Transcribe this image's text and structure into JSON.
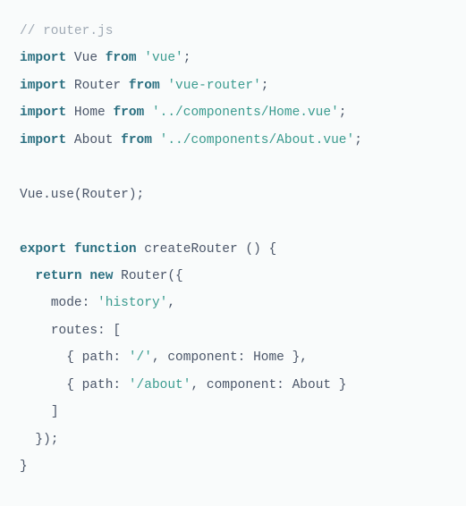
{
  "code": {
    "line1": {
      "comment": "// router.js"
    },
    "line2": {
      "kw": "import",
      "id": " Vue ",
      "kw2": "from",
      "sp": " ",
      "str": "'vue'",
      "end": ";"
    },
    "line3": {
      "kw": "import",
      "id": " Router ",
      "kw2": "from",
      "sp": " ",
      "str": "'vue-router'",
      "end": ";"
    },
    "line4": {
      "kw": "import",
      "id": " Home ",
      "kw2": "from",
      "sp": " ",
      "str": "'../components/Home.vue'",
      "end": ";"
    },
    "line5": {
      "kw": "import",
      "id": " About ",
      "kw2": "from",
      "sp": " ",
      "str": "'../components/About.vue'",
      "end": ";"
    },
    "line7": {
      "text": "Vue.use(Router);"
    },
    "line9": {
      "kw": "export",
      "sp1": " ",
      "kw2": "function",
      "sp2": " ",
      "fn": "createRouter",
      "rest": " () {"
    },
    "line10": {
      "indent": "  ",
      "kw": "return",
      "sp1": " ",
      "kw2": "new",
      "sp2": " ",
      "rest": "Router({"
    },
    "line11": {
      "indent": "    ",
      "key": "mode: ",
      "str": "'history'",
      "end": ","
    },
    "line12": {
      "indent": "    ",
      "text": "routes: ["
    },
    "line13": {
      "indent": "      ",
      "open": "{ path: ",
      "str": "'/'",
      "mid": ", component: Home },"
    },
    "line14": {
      "indent": "      ",
      "open": "{ path: ",
      "str": "'/about'",
      "mid": ", component: About }"
    },
    "line15": {
      "indent": "    ",
      "text": "]"
    },
    "line16": {
      "indent": "  ",
      "text": "});"
    },
    "line17": {
      "text": "}"
    }
  }
}
